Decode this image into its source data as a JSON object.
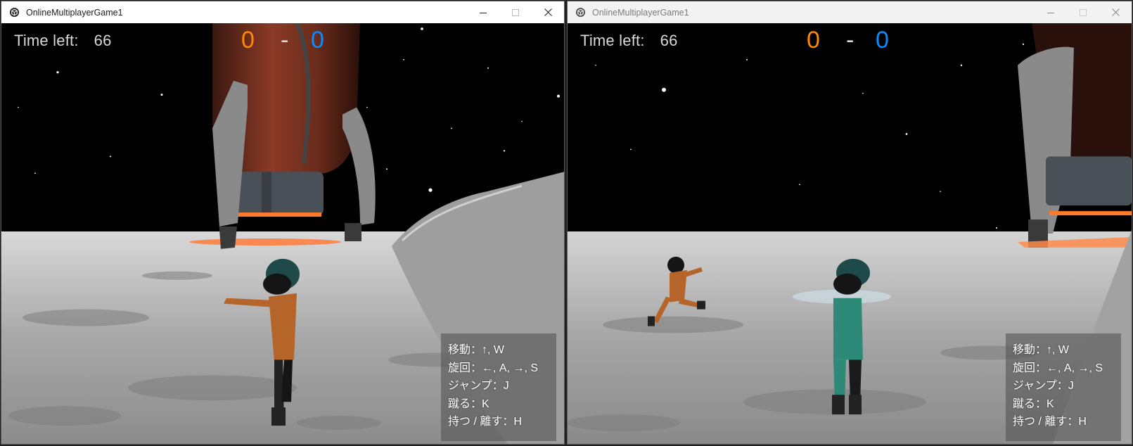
{
  "windows": [
    {
      "id": "left",
      "title": "OnlineMultiplayerGame1",
      "hud": {
        "time_label": "Time left:",
        "time_value": "66",
        "score_orange": "0",
        "score_dash": "-",
        "score_blue": "0"
      },
      "controls_help": [
        "移動：↑, W",
        "旋回：←, A, →, S",
        "ジャンプ：J",
        "蹴る：K",
        "持つ / 離す：H"
      ]
    },
    {
      "id": "right",
      "title": "OnlineMultiplayerGame1",
      "hud": {
        "time_label": "Time left:",
        "time_value": "66",
        "score_orange": "0",
        "score_dash": "-",
        "score_blue": "0"
      },
      "controls_help": [
        "移動：↑, W",
        "旋回：←, A, →, S",
        "ジャンプ：J",
        "蹴る：K",
        "持つ / 離す：H"
      ]
    }
  ],
  "window_controls": {
    "minimize_icon": "minimize-icon",
    "maximize_icon": "maximize-icon",
    "close_icon": "close-icon"
  },
  "colors": {
    "score_orange": "#ff8a00",
    "score_blue": "#0a8cff",
    "player_orange": "#b5652a",
    "player_teal": "#2e8a78"
  }
}
